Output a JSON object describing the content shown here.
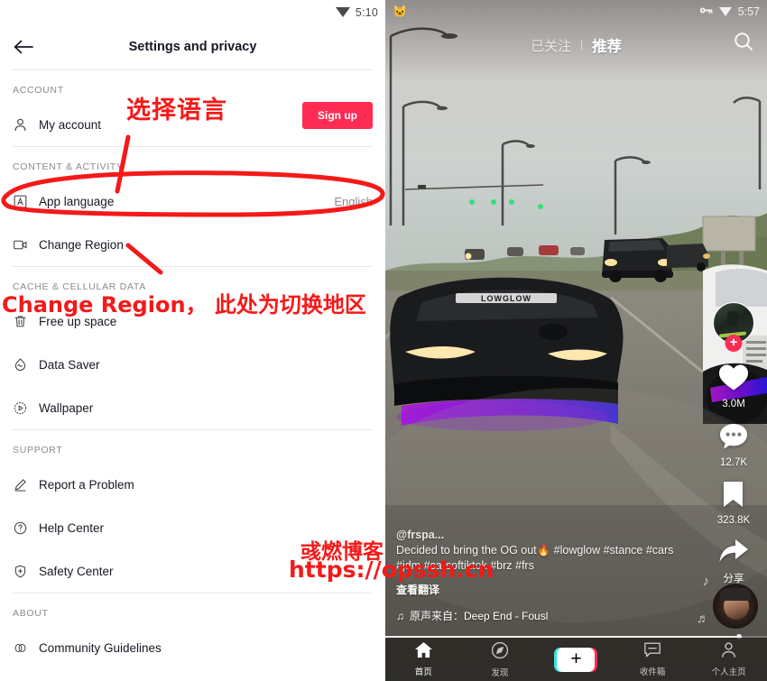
{
  "left": {
    "status": {
      "time": "5:10",
      "wifi_icon": "wifi-icon"
    },
    "appbar": {
      "back_icon": "back-arrow-icon",
      "title": "Settings and privacy"
    },
    "signup_button": {
      "label": "Sign up",
      "color": "#fe2c55"
    },
    "sections": [
      {
        "header": "ACCOUNT",
        "items": [
          {
            "icon": "person-icon",
            "label": "My account",
            "value": ""
          }
        ]
      },
      {
        "header": "CONTENT & ACTIVITY",
        "items": [
          {
            "icon": "letter-a-box-icon",
            "label": "App language",
            "value": "English"
          },
          {
            "icon": "video-camera-icon",
            "label": "Change Region",
            "value": ""
          }
        ]
      },
      {
        "header": "CACHE & CELLULAR DATA",
        "items": [
          {
            "icon": "trash-icon",
            "label": "Free up space",
            "value": ""
          },
          {
            "icon": "data-saver-icon",
            "label": "Data Saver",
            "value": ""
          },
          {
            "icon": "wallpaper-icon",
            "label": "Wallpaper",
            "value": ""
          }
        ]
      },
      {
        "header": "SUPPORT",
        "items": [
          {
            "icon": "pencil-icon",
            "label": "Report a Problem",
            "value": ""
          },
          {
            "icon": "question-circle-icon",
            "label": "Help Center",
            "value": ""
          },
          {
            "icon": "shield-icon",
            "label": "Safety Center",
            "value": ""
          }
        ]
      },
      {
        "header": "ABOUT",
        "items": [
          {
            "icon": "rings-icon",
            "label": "Community Guidelines",
            "value": ""
          }
        ]
      }
    ]
  },
  "annotations": {
    "color": "#f51919",
    "select_language": "选择语言",
    "change_region": "Change Region， 此处为切换地区"
  },
  "watermark": {
    "color": "#f51919",
    "brand": "彧燃博客",
    "url": "https://opssh.cn"
  },
  "right": {
    "status": {
      "cat_icon": "cat-icon",
      "key_icon": "vpn-key-icon",
      "wifi_icon": "wifi-icon",
      "time": "5:57"
    },
    "topnav": {
      "following_label": "已关注",
      "separator": "|",
      "foryou_label": "推荐",
      "search_icon": "search-icon"
    },
    "rail": {
      "avatar_name": "author-avatar",
      "follow_badge": "+",
      "items": [
        {
          "icon": "heart-icon",
          "count": "3.0M"
        },
        {
          "icon": "comment-icon",
          "count": "12.7K"
        },
        {
          "icon": "bookmark-icon",
          "count": "323.8K"
        },
        {
          "icon": "share-arrow-icon",
          "count": "分享"
        }
      ]
    },
    "caption": {
      "username": "@frspa...",
      "text": "Decided to bring the OG out🔥 #lowglow #stance #cars #jdm #carsoftiktok #brz #frs",
      "translate": "查看翻译",
      "music_icon": "music-note-icon",
      "music": "原声来自：Deep End - Fousl"
    },
    "bottomnav": [
      {
        "icon": "home-icon",
        "label": "首页"
      },
      {
        "icon": "compass-icon",
        "label": "发现"
      },
      {
        "icon": "plus-icon",
        "label": ""
      },
      {
        "icon": "inbox-icon",
        "label": "收件箱"
      },
      {
        "icon": "profile-icon",
        "label": "个人主页"
      }
    ],
    "progress_percent": 92
  }
}
